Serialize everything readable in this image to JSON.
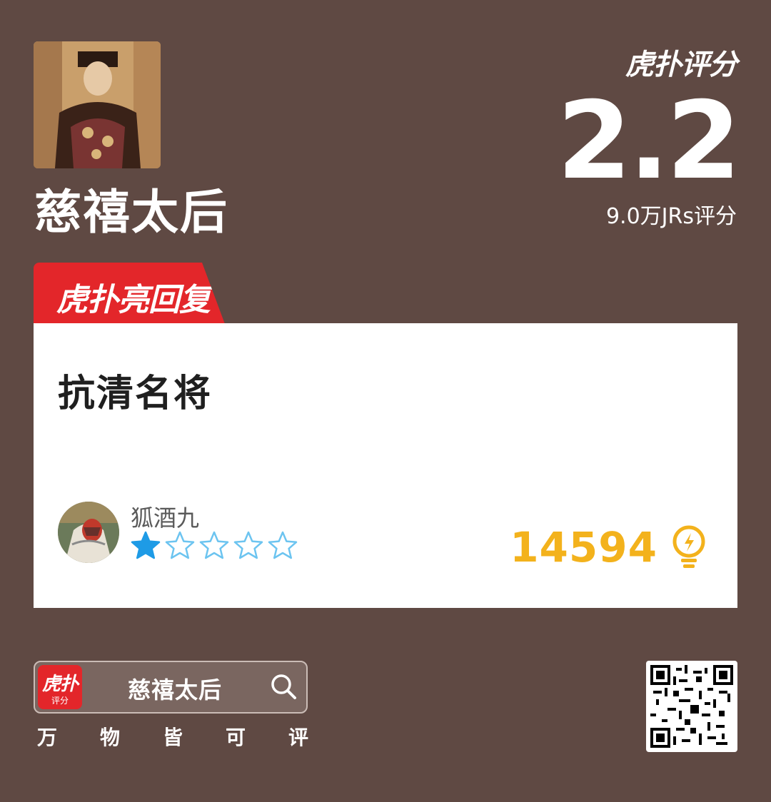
{
  "subject": {
    "name": "慈禧太后"
  },
  "rating": {
    "brand": "虎扑评分",
    "score": "2.2",
    "count_text": "9.0万JRs评分"
  },
  "hot_reply": {
    "tab_label": "虎扑亮回复",
    "comment": "抗清名将",
    "user": {
      "name": "狐酒九",
      "stars": 1,
      "max_stars": 5
    },
    "likes": "14594"
  },
  "footer": {
    "app_logo": "虎扑",
    "app_sub": "评分",
    "search_text": "慈禧太后",
    "slogan": [
      "万",
      "物",
      "皆",
      "可",
      "评"
    ]
  },
  "colors": {
    "background": "#5f4943",
    "accent_red": "#e3262a",
    "like_yellow": "#f3b21c",
    "star_blue": "#1e9be6"
  },
  "icons": {
    "search": "search-icon",
    "like": "lightbulb-icon",
    "star": "star-icon",
    "qr": "qr-code"
  }
}
